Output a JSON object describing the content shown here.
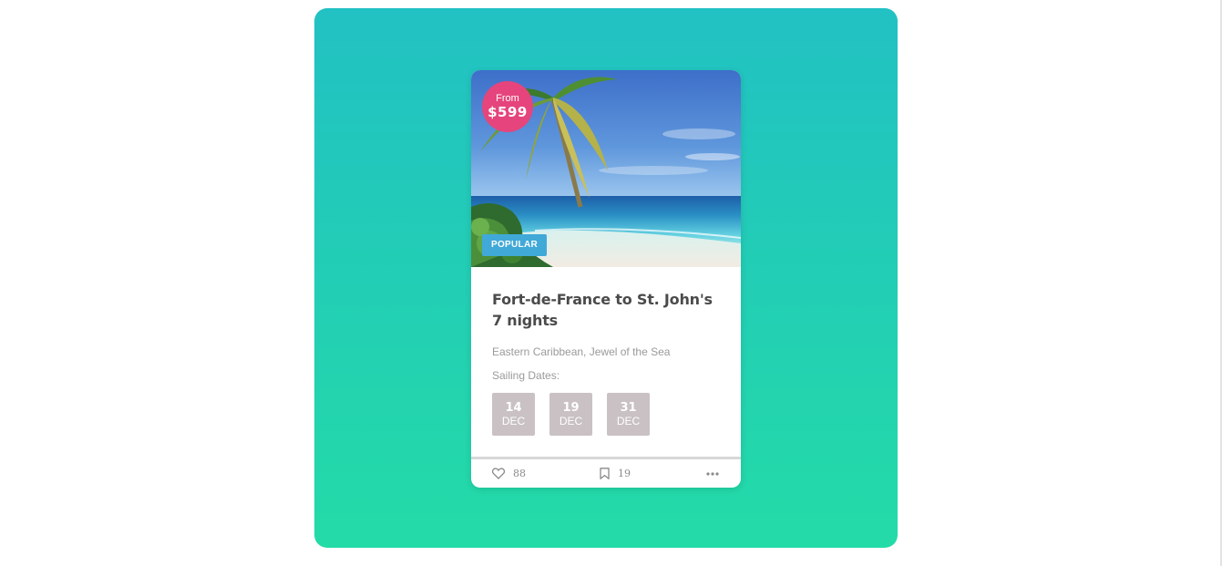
{
  "colors": {
    "gradient_top": "#22c1c3",
    "gradient_bottom": "#23dba7",
    "price_badge": "#e5457c",
    "popular_tag": "#40a9d8",
    "date_box": "#c9c1c3",
    "title_text": "#4b4b4b",
    "muted_text": "#9a9a9a"
  },
  "card": {
    "image_alt": "tropical beach with palm tree",
    "price": {
      "from_label": "From",
      "amount": "$599"
    },
    "tag": "POPULAR",
    "title": "Fort-de-France to St. John's 7 nights",
    "subtitle": "Eastern Caribbean, Jewel of the Sea",
    "sailing_label": "Sailing Dates:",
    "dates": [
      {
        "day": "14",
        "month": "DEC"
      },
      {
        "day": "19",
        "month": "DEC"
      },
      {
        "day": "31",
        "month": "DEC"
      }
    ],
    "footer": {
      "likes": "88",
      "bookmarks": "19",
      "like_icon": "heart-icon",
      "bookmark_icon": "bookmark-icon",
      "more_icon": "more-dots-icon"
    }
  }
}
